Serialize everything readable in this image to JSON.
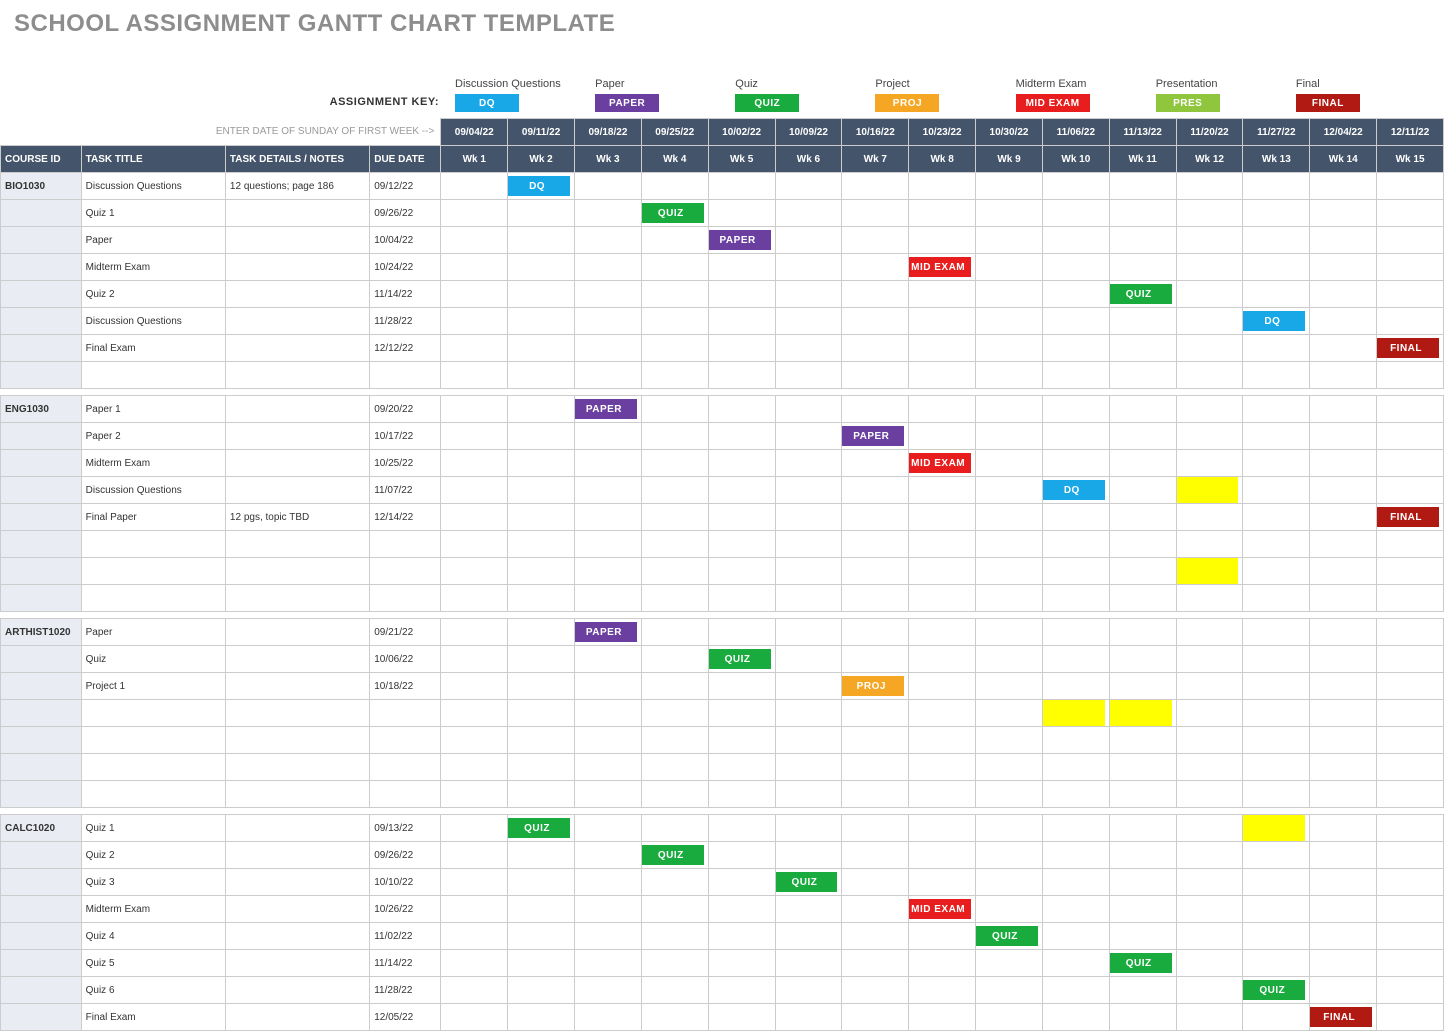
{
  "title": "SCHOOL ASSIGNMENT GANTT CHART TEMPLATE",
  "key_label": "ASSIGNMENT KEY:",
  "legend": [
    {
      "name": "Discussion Questions",
      "short": "DQ",
      "color": "#18a8e8"
    },
    {
      "name": "Paper",
      "short": "PAPER",
      "color": "#6b3fa0"
    },
    {
      "name": "Quiz",
      "short": "QUIZ",
      "color": "#1aab3e"
    },
    {
      "name": "Project",
      "short": "PROJ",
      "color": "#f5a623"
    },
    {
      "name": "Midterm Exam",
      "short": "MID EXAM",
      "color": "#e81e1e"
    },
    {
      "name": "Presentation",
      "short": "PRES",
      "color": "#8fc63d"
    },
    {
      "name": "Final",
      "short": "FINAL",
      "color": "#b11a12"
    }
  ],
  "prompt": "ENTER DATE OF SUNDAY OF FIRST WEEK -->",
  "dates": [
    "09/04/22",
    "09/11/22",
    "09/18/22",
    "09/25/22",
    "10/02/22",
    "10/09/22",
    "10/16/22",
    "10/23/22",
    "10/30/22",
    "11/06/22",
    "11/13/22",
    "11/20/22",
    "11/27/22",
    "12/04/22",
    "12/11/22"
  ],
  "weeks": [
    "Wk 1",
    "Wk 2",
    "Wk 3",
    "Wk 4",
    "Wk 5",
    "Wk 6",
    "Wk 7",
    "Wk 8",
    "Wk 9",
    "Wk 10",
    "Wk 11",
    "Wk 12",
    "Wk 13",
    "Wk 14",
    "Wk 15"
  ],
  "hdr": {
    "course": "COURSE ID",
    "task": "TASK TITLE",
    "notes": "TASK DETAILS / NOTES",
    "due": "DUE DATE"
  },
  "colors": {
    "DQ": "#18a8e8",
    "PAPER": "#6b3fa0",
    "QUIZ": "#1aab3e",
    "PROJ": "#f5a623",
    "MID EXAM": "#e81e1e",
    "PRES": "#8fc63d",
    "FINAL": "#b11a12"
  },
  "rows": [
    {
      "course": "BIO1030",
      "task": "Discussion Questions",
      "notes": "12 questions; page 186",
      "due": "09/12/22",
      "cells": {
        "2": "DQ"
      }
    },
    {
      "course": "",
      "task": "Quiz 1",
      "notes": "",
      "due": "09/26/22",
      "cells": {
        "4": "QUIZ"
      }
    },
    {
      "course": "",
      "task": "Paper",
      "notes": "",
      "due": "10/04/22",
      "cells": {
        "5": "PAPER"
      }
    },
    {
      "course": "",
      "task": "Midterm Exam",
      "notes": "",
      "due": "10/24/22",
      "cells": {
        "8": "MID EXAM"
      }
    },
    {
      "course": "",
      "task": "Quiz 2",
      "notes": "",
      "due": "11/14/22",
      "cells": {
        "11": "QUIZ"
      }
    },
    {
      "course": "",
      "task": "Discussion Questions",
      "notes": "",
      "due": "11/28/22",
      "cells": {
        "13": "DQ"
      }
    },
    {
      "course": "",
      "task": "Final Exam",
      "notes": "",
      "due": "12/12/22",
      "cells": {
        "15": "FINAL"
      }
    },
    {
      "course": "",
      "task": "",
      "notes": "",
      "due": "",
      "cells": {}
    },
    {
      "sep": true
    },
    {
      "course": "ENG1030",
      "task": "Paper 1",
      "notes": "",
      "due": "09/20/22",
      "cells": {
        "3": "PAPER"
      }
    },
    {
      "course": "",
      "task": "Paper 2",
      "notes": "",
      "due": "10/17/22",
      "cells": {
        "7": "PAPER"
      }
    },
    {
      "course": "",
      "task": "Midterm Exam",
      "notes": "",
      "due": "10/25/22",
      "cells": {
        "8": "MID EXAM"
      }
    },
    {
      "course": "",
      "task": "Discussion Questions",
      "notes": "",
      "due": "11/07/22",
      "cells": {
        "10": "DQ",
        "12": "YELLOW"
      }
    },
    {
      "course": "",
      "task": "Final Paper",
      "notes": "12 pgs, topic TBD",
      "due": "12/14/22",
      "cells": {
        "15": "FINAL"
      }
    },
    {
      "course": "",
      "task": "",
      "notes": "",
      "due": "",
      "cells": {}
    },
    {
      "course": "",
      "task": "",
      "notes": "",
      "due": "",
      "cells": {
        "12": "YELLOW"
      }
    },
    {
      "course": "",
      "task": "",
      "notes": "",
      "due": "",
      "cells": {}
    },
    {
      "sep": true
    },
    {
      "course": "ARTHIST1020",
      "task": "Paper",
      "notes": "",
      "due": "09/21/22",
      "cells": {
        "3": "PAPER"
      }
    },
    {
      "course": "",
      "task": "Quiz",
      "notes": "",
      "due": "10/06/22",
      "cells": {
        "5": "QUIZ"
      }
    },
    {
      "course": "",
      "task": "Project 1",
      "notes": "",
      "due": "10/18/22",
      "cells": {
        "7": "PROJ"
      }
    },
    {
      "course": "",
      "task": "",
      "notes": "",
      "due": "",
      "cells": {
        "10": "YELLOW",
        "11": "YELLOW"
      }
    },
    {
      "course": "",
      "task": "",
      "notes": "",
      "due": "",
      "cells": {}
    },
    {
      "course": "",
      "task": "",
      "notes": "",
      "due": "",
      "cells": {}
    },
    {
      "course": "",
      "task": "",
      "notes": "",
      "due": "",
      "cells": {}
    },
    {
      "sep": true
    },
    {
      "course": "CALC1020",
      "task": "Quiz 1",
      "notes": "",
      "due": "09/13/22",
      "cells": {
        "2": "QUIZ",
        "13": "YELLOW"
      }
    },
    {
      "course": "",
      "task": "Quiz 2",
      "notes": "",
      "due": "09/26/22",
      "cells": {
        "4": "QUIZ"
      }
    },
    {
      "course": "",
      "task": "Quiz 3",
      "notes": "",
      "due": "10/10/22",
      "cells": {
        "6": "QUIZ"
      }
    },
    {
      "course": "",
      "task": "Midterm Exam",
      "notes": "",
      "due": "10/26/22",
      "cells": {
        "8": "MID EXAM"
      }
    },
    {
      "course": "",
      "task": "Quiz 4",
      "notes": "",
      "due": "11/02/22",
      "cells": {
        "9": "QUIZ"
      }
    },
    {
      "course": "",
      "task": "Quiz 5",
      "notes": "",
      "due": "11/14/22",
      "cells": {
        "11": "QUIZ"
      }
    },
    {
      "course": "",
      "task": "Quiz 6",
      "notes": "",
      "due": "11/28/22",
      "cells": {
        "13": "QUIZ"
      }
    },
    {
      "course": "",
      "task": "Final Exam",
      "notes": "",
      "due": "12/05/22",
      "cells": {
        "14": "FINAL"
      }
    }
  ],
  "chart_data": {
    "type": "table",
    "title": "School Assignment Gantt Chart Template",
    "weeks": 15,
    "week_start_dates": [
      "09/04/22",
      "09/11/22",
      "09/18/22",
      "09/25/22",
      "10/02/22",
      "10/09/22",
      "10/16/22",
      "10/23/22",
      "10/30/22",
      "11/06/22",
      "11/13/22",
      "11/20/22",
      "11/27/22",
      "12/04/22",
      "12/11/22"
    ],
    "courses": [
      {
        "id": "BIO1030",
        "tasks": [
          {
            "title": "Discussion Questions",
            "notes": "12 questions; page 186",
            "due": "09/12/22",
            "type": "DQ",
            "week": 2
          },
          {
            "title": "Quiz 1",
            "due": "09/26/22",
            "type": "QUIZ",
            "week": 4
          },
          {
            "title": "Paper",
            "due": "10/04/22",
            "type": "PAPER",
            "week": 5
          },
          {
            "title": "Midterm Exam",
            "due": "10/24/22",
            "type": "MID EXAM",
            "week": 8
          },
          {
            "title": "Quiz 2",
            "due": "11/14/22",
            "type": "QUIZ",
            "week": 11
          },
          {
            "title": "Discussion Questions",
            "due": "11/28/22",
            "type": "DQ",
            "week": 13
          },
          {
            "title": "Final Exam",
            "due": "12/12/22",
            "type": "FINAL",
            "week": 15
          }
        ]
      },
      {
        "id": "ENG1030",
        "tasks": [
          {
            "title": "Paper 1",
            "due": "09/20/22",
            "type": "PAPER",
            "week": 3
          },
          {
            "title": "Paper 2",
            "due": "10/17/22",
            "type": "PAPER",
            "week": 7
          },
          {
            "title": "Midterm Exam",
            "due": "10/25/22",
            "type": "MID EXAM",
            "week": 8
          },
          {
            "title": "Discussion Questions",
            "due": "11/07/22",
            "type": "DQ",
            "week": 10
          },
          {
            "title": "Final Paper",
            "notes": "12 pgs, topic TBD",
            "due": "12/14/22",
            "type": "FINAL",
            "week": 15
          }
        ]
      },
      {
        "id": "ARTHIST1020",
        "tasks": [
          {
            "title": "Paper",
            "due": "09/21/22",
            "type": "PAPER",
            "week": 3
          },
          {
            "title": "Quiz",
            "due": "10/06/22",
            "type": "QUIZ",
            "week": 5
          },
          {
            "title": "Project 1",
            "due": "10/18/22",
            "type": "PROJ",
            "week": 7
          }
        ]
      },
      {
        "id": "CALC1020",
        "tasks": [
          {
            "title": "Quiz 1",
            "due": "09/13/22",
            "type": "QUIZ",
            "week": 2
          },
          {
            "title": "Quiz 2",
            "due": "09/26/22",
            "type": "QUIZ",
            "week": 4
          },
          {
            "title": "Quiz 3",
            "due": "10/10/22",
            "type": "QUIZ",
            "week": 6
          },
          {
            "title": "Midterm Exam",
            "due": "10/26/22",
            "type": "MID EXAM",
            "week": 8
          },
          {
            "title": "Quiz 4",
            "due": "11/02/22",
            "type": "QUIZ",
            "week": 9
          },
          {
            "title": "Quiz 5",
            "due": "11/14/22",
            "type": "QUIZ",
            "week": 11
          },
          {
            "title": "Quiz 6",
            "due": "11/28/22",
            "type": "QUIZ",
            "week": 13
          },
          {
            "title": "Final Exam",
            "due": "12/05/22",
            "type": "FINAL",
            "week": 14
          }
        ]
      }
    ]
  }
}
